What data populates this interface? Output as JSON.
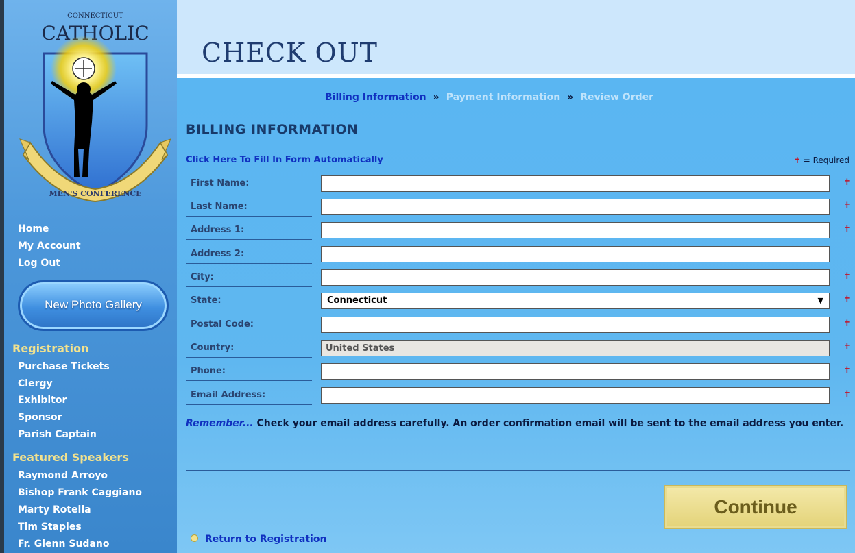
{
  "logo": {
    "top_text": "CONNECTICUT",
    "name": "CATHOLIC",
    "banner": "MEN'S CONFERENCE"
  },
  "sidebar": {
    "top_links": [
      "Home",
      "My Account",
      "Log Out"
    ],
    "gallery_button": "New Photo Gallery",
    "registration": {
      "heading": "Registration",
      "links": [
        "Purchase Tickets",
        "Clergy",
        "Exhibitor",
        "Sponsor",
        "Parish Captain"
      ]
    },
    "speakers": {
      "heading": "Featured Speakers",
      "links": [
        "Raymond Arroyo",
        "Bishop Frank Caggiano",
        "Marty Rotella",
        "Tim Staples",
        "Fr. Glenn Sudano"
      ]
    }
  },
  "header": {
    "title": "CHECK OUT"
  },
  "steps": {
    "billing": "Billing Information",
    "payment": "Payment Information",
    "review": "Review Order",
    "separator": "»"
  },
  "billing": {
    "heading": "BILLING INFORMATION",
    "autofill_link": "Click Here To Fill In Form Automatically",
    "required_cross": "✝",
    "required_note": " = Required",
    "fields": {
      "first_name": {
        "label": "First Name:",
        "value": ""
      },
      "last_name": {
        "label": "Last Name:",
        "value": ""
      },
      "address1": {
        "label": "Address 1:",
        "value": ""
      },
      "address2": {
        "label": "Address 2:",
        "value": ""
      },
      "city": {
        "label": "City:",
        "value": ""
      },
      "state": {
        "label": "State:",
        "value": "Connecticut"
      },
      "postal": {
        "label": "Postal Code:",
        "value": ""
      },
      "country": {
        "label": "Country:",
        "value": "United States"
      },
      "phone": {
        "label": "Phone:",
        "value": ""
      },
      "email": {
        "label": "Email Address:",
        "value": ""
      }
    },
    "remember_lead": "Remember...",
    "remember_text": " Check your email address carefully. An order confirmation email will be sent to the email address you enter.",
    "continue_label": "Continue",
    "return_link": "Return to Registration"
  },
  "colors": {
    "link_blue": "#1030c0",
    "required_red": "#c0142a",
    "heading_gold": "#f2e28e"
  }
}
